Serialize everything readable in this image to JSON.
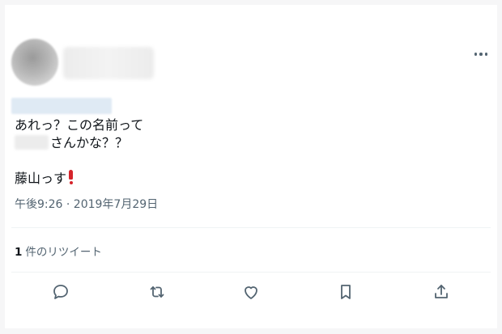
{
  "tweet": {
    "more_icon": "more-horizontal-icon",
    "text_line1": "あれっ？この名前って",
    "text_line2_suffix": "さんかな？？",
    "text_line3": "藤山っす",
    "exclamation_emoji": "heavy-exclamation-mark-icon",
    "timestamp": "午後9:26 · 2019年7月29日"
  },
  "stats": {
    "retweet_count": "1",
    "retweet_label": "件のリツイート"
  },
  "actions": [
    {
      "name": "reply-icon"
    },
    {
      "name": "retweet-icon"
    },
    {
      "name": "like-icon"
    },
    {
      "name": "bookmark-icon"
    },
    {
      "name": "share-icon"
    }
  ],
  "colors": {
    "text": "#0f1419",
    "secondary": "#536471",
    "divider": "#eff3f4",
    "emoji_red": "#d6242b"
  }
}
